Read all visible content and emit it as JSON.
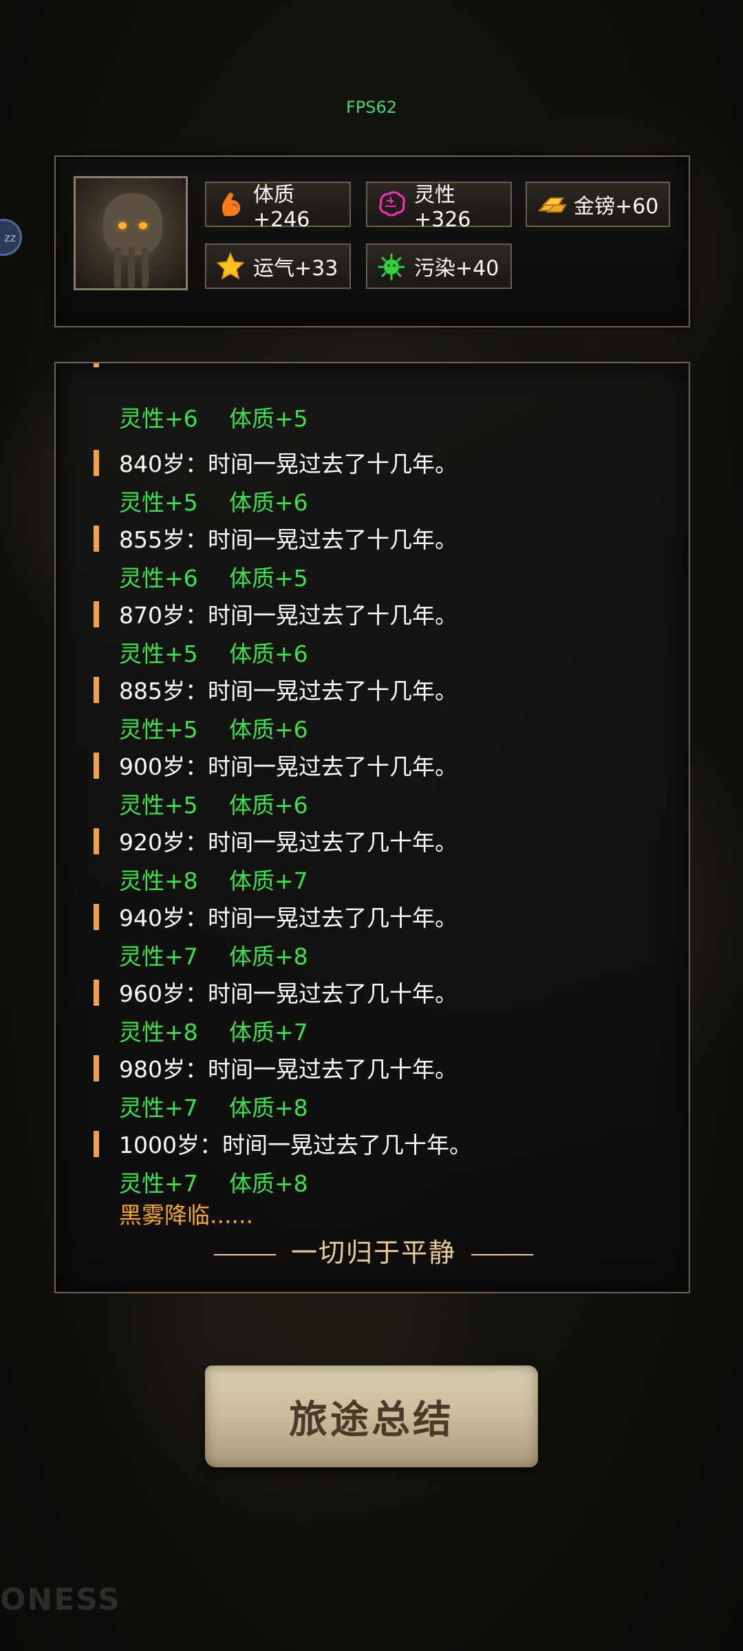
{
  "fps": "FPS62",
  "side_bubble": "zz",
  "stats": {
    "physique": "体质+246",
    "spirit": "灵性+326",
    "gold": "金镑+60",
    "luck": "运气+33",
    "pollution": "污染+40"
  },
  "log": {
    "partial_gains": [
      "灵性+6",
      "体质+5"
    ],
    "entries": [
      {
        "text": "840岁：时间一晃过去了十几年。",
        "gains": [
          "灵性+5",
          "体质+6"
        ]
      },
      {
        "text": "855岁：时间一晃过去了十几年。",
        "gains": [
          "灵性+6",
          "体质+5"
        ]
      },
      {
        "text": "870岁：时间一晃过去了十几年。",
        "gains": [
          "灵性+5",
          "体质+6"
        ]
      },
      {
        "text": "885岁：时间一晃过去了十几年。",
        "gains": [
          "灵性+5",
          "体质+6"
        ]
      },
      {
        "text": "900岁：时间一晃过去了十几年。",
        "gains": [
          "灵性+5",
          "体质+6"
        ]
      },
      {
        "text": "920岁：时间一晃过去了几十年。",
        "gains": [
          "灵性+8",
          "体质+7"
        ]
      },
      {
        "text": "940岁：时间一晃过去了几十年。",
        "gains": [
          "灵性+7",
          "体质+8"
        ]
      },
      {
        "text": "960岁：时间一晃过去了几十年。",
        "gains": [
          "灵性+8",
          "体质+7"
        ]
      },
      {
        "text": "980岁：时间一晃过去了几十年。",
        "gains": [
          "灵性+7",
          "体质+8"
        ]
      },
      {
        "text": "1000岁：时间一晃过去了几十年。",
        "gains": [
          "灵性+7",
          "体质+8"
        ]
      }
    ],
    "fog": "黑雾降临......",
    "finale": "一切归于平静"
  },
  "summary_button": "旅途总结",
  "watermark": "ONESS"
}
